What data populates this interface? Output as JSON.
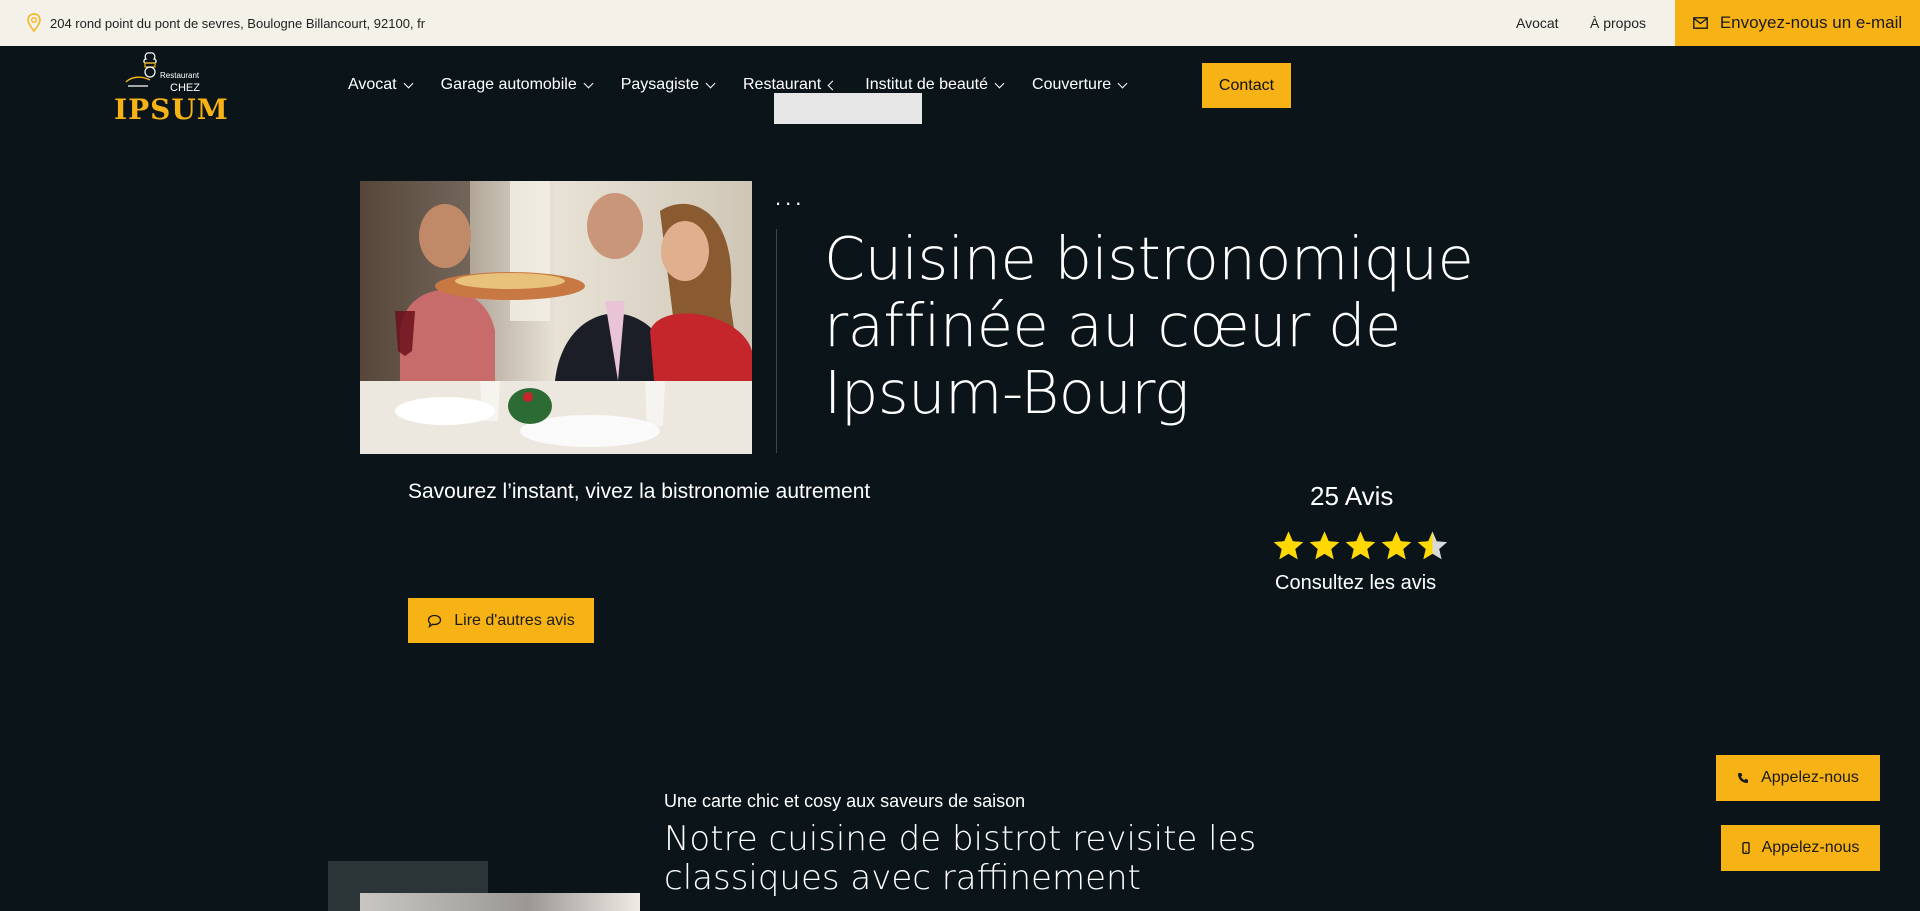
{
  "topbar": {
    "address": "204 rond point du pont de sevres, Boulogne Billancourt, 92100, fr",
    "links": [
      "Avocat",
      "À propos"
    ],
    "email_button": "Envoyez-nous un e-mail"
  },
  "logo": {
    "line1": "Restaurant",
    "line2": "CHEZ",
    "name": "IPSUM"
  },
  "nav": {
    "items": [
      {
        "label": "Avocat"
      },
      {
        "label": "Garage automobile"
      },
      {
        "label": "Paysagiste"
      },
      {
        "label": "Restaurant"
      },
      {
        "label": "Institut de beauté"
      },
      {
        "label": "Couverture"
      }
    ],
    "contact": "Contact"
  },
  "hero": {
    "dots": "...",
    "title": "Cuisine bistronomique raffinée au cœur de Ipsum-Bourg",
    "tagline": "Savourez l’instant, vivez la bistronomie autrement",
    "reviews_count": "25 Avis",
    "rating": 4.5,
    "rating_max": 5,
    "consult": "Consultez les avis",
    "read_button": "Lire d'autres avis"
  },
  "section": {
    "kicker": "Une carte chic et cosy aux saveurs de saison",
    "title": "Notre cuisine de bistrot revisite les classiques avec raffinement"
  },
  "floating": {
    "call1": "Appelez-nous",
    "call2": "Appelez-nous"
  },
  "colors": {
    "accent": "#f7b315",
    "background": "#0b1418",
    "topbar": "#f4f1e8"
  }
}
